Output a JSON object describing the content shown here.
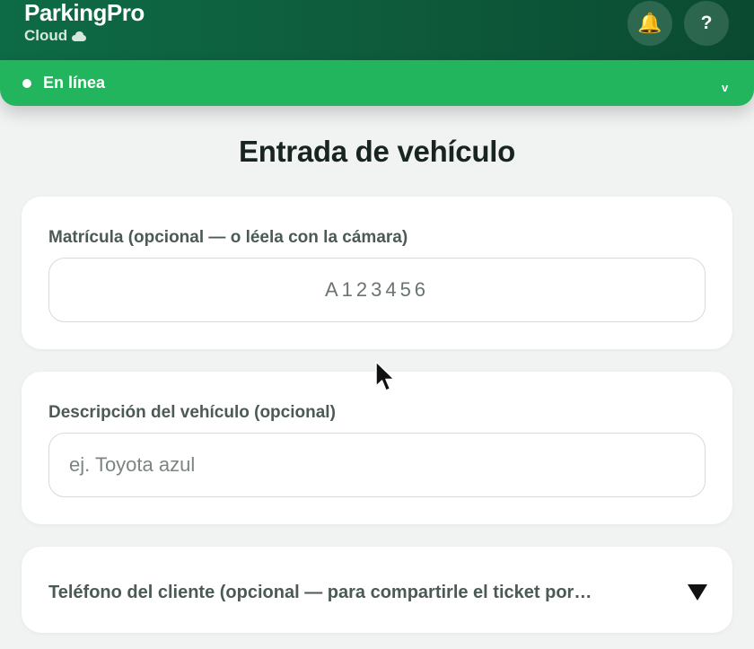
{
  "header": {
    "brand_name": "ParkingPro",
    "brand_sub": "Cloud",
    "bell_icon": "bell-icon",
    "help_label": "?",
    "colors": {
      "header": "#0e5a3b",
      "status": "#23b55e",
      "bell": "#f5b22a"
    }
  },
  "status": {
    "text": "En línea",
    "chevron": "v"
  },
  "main": {
    "title": "Entrada de vehículo"
  },
  "plate": {
    "label": "Matrícula (opcional — o léela con la cámara)",
    "value": "",
    "placeholder": "A123456"
  },
  "description": {
    "label": "Descripción del vehículo (opcional)",
    "value": "",
    "placeholder": "ej. Toyota azul"
  },
  "phone": {
    "label": "Teléfono del cliente (opcional — para compartirle el ticket por…",
    "expand_icon": "triangle-down-icon"
  }
}
